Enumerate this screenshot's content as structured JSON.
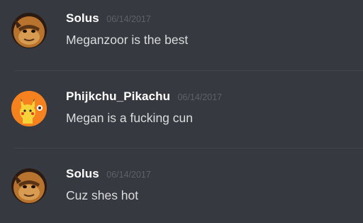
{
  "messages": [
    {
      "author": "Solus",
      "timestamp": "06/14/2017",
      "text": "Meganzoor is the best",
      "avatar_icon": "solus-avatar-icon"
    },
    {
      "author": "Phijkchu_Pikachu",
      "timestamp": "06/14/2017",
      "text": "Megan is a fucking cun",
      "avatar_icon": "pikachu-avatar-icon"
    },
    {
      "author": "Solus",
      "timestamp": "06/14/2017",
      "text": "Cuz shes hot",
      "avatar_icon": "solus-avatar-icon"
    }
  ],
  "colors": {
    "background": "#36393f",
    "username": "#ffffff",
    "timestamp": "#5e6167",
    "message_text": "#dcddde",
    "divider": "#42454a"
  }
}
